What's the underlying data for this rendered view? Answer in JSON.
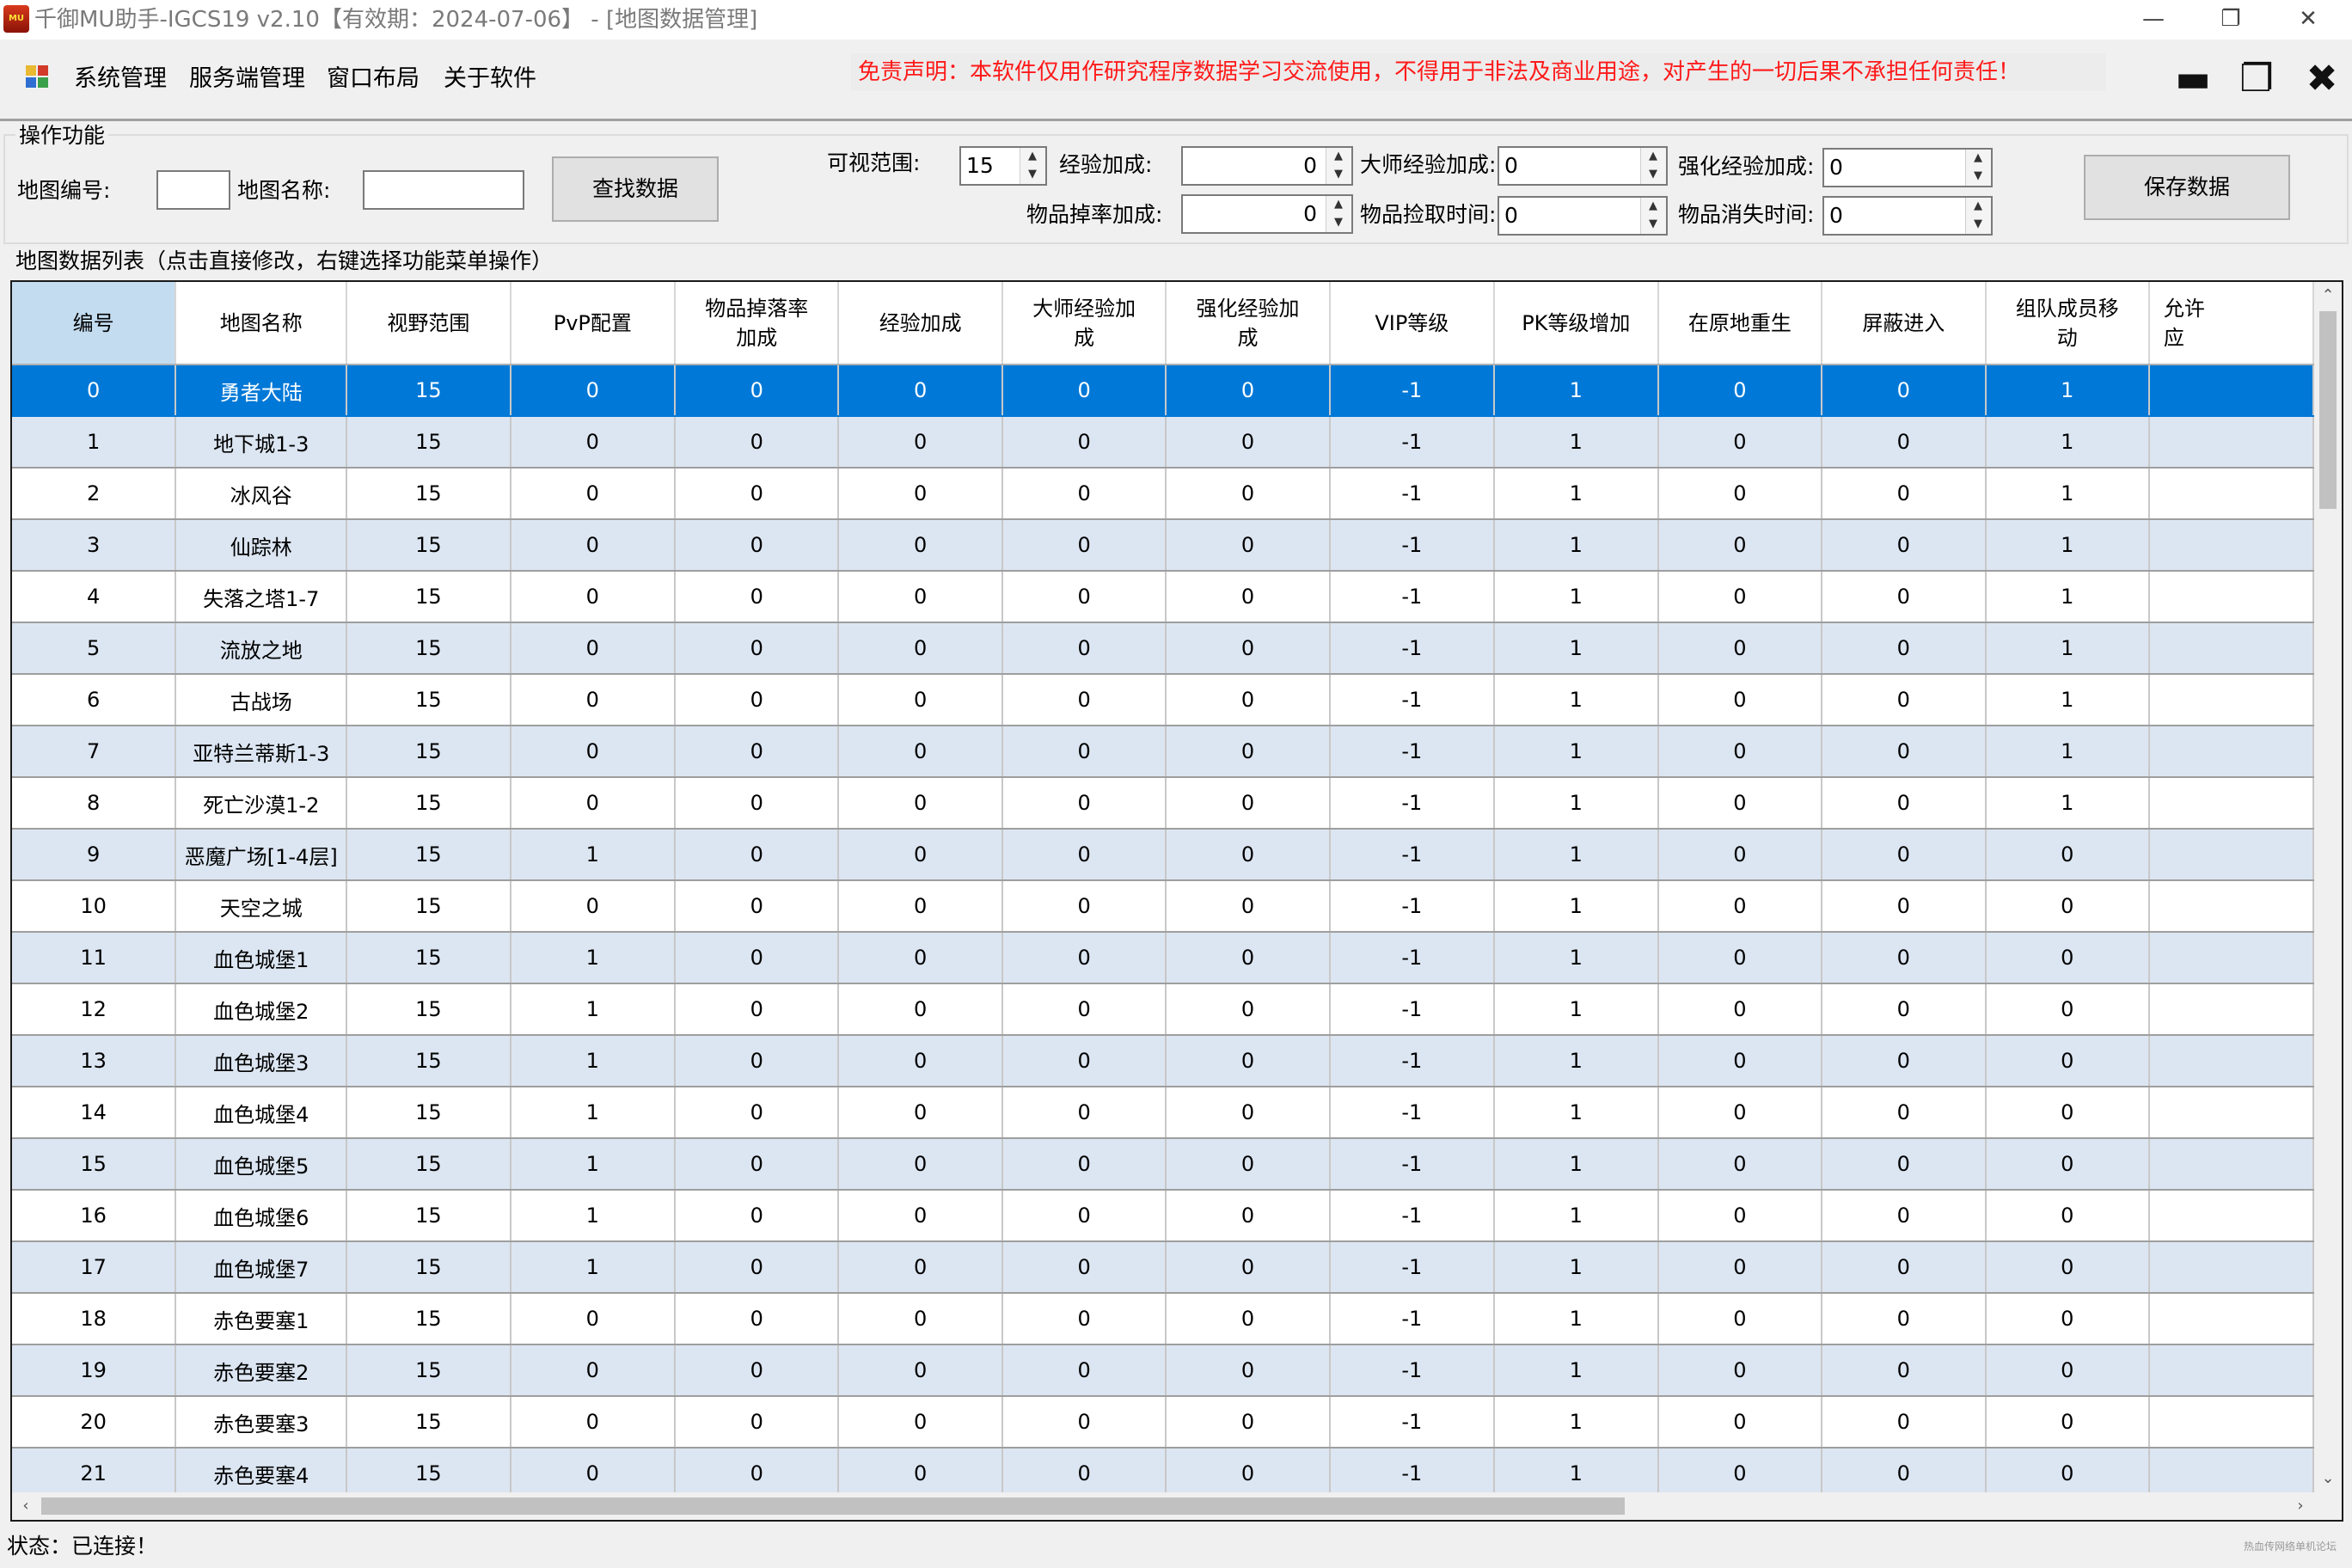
{
  "window": {
    "title": "千御MU助手-IGCS19 v2.10【有效期：2024-07-06】 - [地图数据管理]",
    "minimize_glyph": "—",
    "restore_glyph": "❐",
    "close_glyph": "✕"
  },
  "menu": {
    "items": [
      "系统管理",
      "服务端管理",
      "窗口布局",
      "关于软件"
    ],
    "disclaimer": "免责声明：本软件仅用作研究程序数据学习交流使用，不得用于非法及商业用途，对产生的一切后果不承担任何责任！",
    "mdi_minimize": "▬",
    "mdi_restore": "❐",
    "mdi_close": "✖"
  },
  "ops": {
    "legend": "操作功能",
    "map_id_label": "地图编号:",
    "map_id_value": "",
    "map_name_label": "地图名称:",
    "map_name_value": "",
    "search_button": "查找数据",
    "view_range_label": "可视范围:",
    "view_range_value": "15",
    "exp_bonus_label": "经验加成:",
    "exp_bonus_value": "0",
    "master_exp_label": "大师经验加成:",
    "master_exp_value": "0",
    "enhance_exp_label": "强化经验加成:",
    "enhance_exp_value": "0",
    "drop_rate_label": "物品掉率加成:",
    "drop_rate_value": "0",
    "pickup_time_label": "物品捡取时间:",
    "pickup_time_value": "0",
    "vanish_time_label": "物品消失时间:",
    "vanish_time_value": "0",
    "save_button": "保存数据"
  },
  "list_caption": "地图数据列表（点击直接修改，右键选择功能菜单操作）",
  "table": {
    "columns": [
      "编号",
      "地图名称",
      "视野范围",
      "PvP配置",
      "物品掉落率加成",
      "经验加成",
      "大师经验加成",
      "强化经验加成",
      "VIP等级",
      "PK等级增加",
      "在原地重生",
      "屏蔽进入",
      "组队成员移动",
      "允许..."
    ],
    "header_lines": [
      [
        "编号"
      ],
      [
        "地图名称"
      ],
      [
        "视野范围"
      ],
      [
        "PvP配置"
      ],
      [
        "物品掉落率",
        "加成"
      ],
      [
        "经验加成"
      ],
      [
        "大师经验加",
        "成"
      ],
      [
        "强化经验加",
        "成"
      ],
      [
        "VIP等级"
      ],
      [
        "PK等级增加"
      ],
      [
        "在原地重生"
      ],
      [
        "屏蔽进入"
      ],
      [
        "组队成员移",
        "动"
      ],
      [
        "允许",
        "应"
      ]
    ],
    "selected_row": 0,
    "rows": [
      [
        "0",
        "勇者大陆",
        "15",
        "0",
        "0",
        "0",
        "0",
        "0",
        "-1",
        "1",
        "0",
        "0",
        "1",
        ""
      ],
      [
        "1",
        "地下城1-3",
        "15",
        "0",
        "0",
        "0",
        "0",
        "0",
        "-1",
        "1",
        "0",
        "0",
        "1",
        ""
      ],
      [
        "2",
        "冰风谷",
        "15",
        "0",
        "0",
        "0",
        "0",
        "0",
        "-1",
        "1",
        "0",
        "0",
        "1",
        ""
      ],
      [
        "3",
        "仙踪林",
        "15",
        "0",
        "0",
        "0",
        "0",
        "0",
        "-1",
        "1",
        "0",
        "0",
        "1",
        ""
      ],
      [
        "4",
        "失落之塔1-7",
        "15",
        "0",
        "0",
        "0",
        "0",
        "0",
        "-1",
        "1",
        "0",
        "0",
        "1",
        ""
      ],
      [
        "5",
        "流放之地",
        "15",
        "0",
        "0",
        "0",
        "0",
        "0",
        "-1",
        "1",
        "0",
        "0",
        "1",
        ""
      ],
      [
        "6",
        "古战场",
        "15",
        "0",
        "0",
        "0",
        "0",
        "0",
        "-1",
        "1",
        "0",
        "0",
        "1",
        ""
      ],
      [
        "7",
        "亚特兰蒂斯1-3",
        "15",
        "0",
        "0",
        "0",
        "0",
        "0",
        "-1",
        "1",
        "0",
        "0",
        "1",
        ""
      ],
      [
        "8",
        "死亡沙漠1-2",
        "15",
        "0",
        "0",
        "0",
        "0",
        "0",
        "-1",
        "1",
        "0",
        "0",
        "1",
        ""
      ],
      [
        "9",
        "恶魔广场[1-4层]",
        "15",
        "1",
        "0",
        "0",
        "0",
        "0",
        "-1",
        "1",
        "0",
        "0",
        "0",
        ""
      ],
      [
        "10",
        "天空之城",
        "15",
        "0",
        "0",
        "0",
        "0",
        "0",
        "-1",
        "1",
        "0",
        "0",
        "0",
        ""
      ],
      [
        "11",
        "血色城堡1",
        "15",
        "1",
        "0",
        "0",
        "0",
        "0",
        "-1",
        "1",
        "0",
        "0",
        "0",
        ""
      ],
      [
        "12",
        "血色城堡2",
        "15",
        "1",
        "0",
        "0",
        "0",
        "0",
        "-1",
        "1",
        "0",
        "0",
        "0",
        ""
      ],
      [
        "13",
        "血色城堡3",
        "15",
        "1",
        "0",
        "0",
        "0",
        "0",
        "-1",
        "1",
        "0",
        "0",
        "0",
        ""
      ],
      [
        "14",
        "血色城堡4",
        "15",
        "1",
        "0",
        "0",
        "0",
        "0",
        "-1",
        "1",
        "0",
        "0",
        "0",
        ""
      ],
      [
        "15",
        "血色城堡5",
        "15",
        "1",
        "0",
        "0",
        "0",
        "0",
        "-1",
        "1",
        "0",
        "0",
        "0",
        ""
      ],
      [
        "16",
        "血色城堡6",
        "15",
        "1",
        "0",
        "0",
        "0",
        "0",
        "-1",
        "1",
        "0",
        "0",
        "0",
        ""
      ],
      [
        "17",
        "血色城堡7",
        "15",
        "1",
        "0",
        "0",
        "0",
        "0",
        "-1",
        "1",
        "0",
        "0",
        "0",
        ""
      ],
      [
        "18",
        "赤色要塞1",
        "15",
        "0",
        "0",
        "0",
        "0",
        "0",
        "-1",
        "1",
        "0",
        "0",
        "0",
        ""
      ],
      [
        "19",
        "赤色要塞2",
        "15",
        "0",
        "0",
        "0",
        "0",
        "0",
        "-1",
        "1",
        "0",
        "0",
        "0",
        ""
      ],
      [
        "20",
        "赤色要塞3",
        "15",
        "0",
        "0",
        "0",
        "0",
        "0",
        "-1",
        "1",
        "0",
        "0",
        "0",
        ""
      ],
      [
        "21",
        "赤色要塞4",
        "15",
        "0",
        "0",
        "0",
        "0",
        "0",
        "-1",
        "1",
        "0",
        "0",
        "0",
        ""
      ]
    ]
  },
  "scroll": {
    "up": "⌃",
    "down": "⌄",
    "left": "‹",
    "right": "›"
  },
  "status": {
    "text": "状态：已连接！",
    "watermark": "热血传网络单机论坛"
  },
  "colors": {
    "selection": "#0078d7",
    "alt_row": "#dce6f2",
    "disclaimer": "#ff1a1a",
    "header_first": "#c3dcf0"
  }
}
